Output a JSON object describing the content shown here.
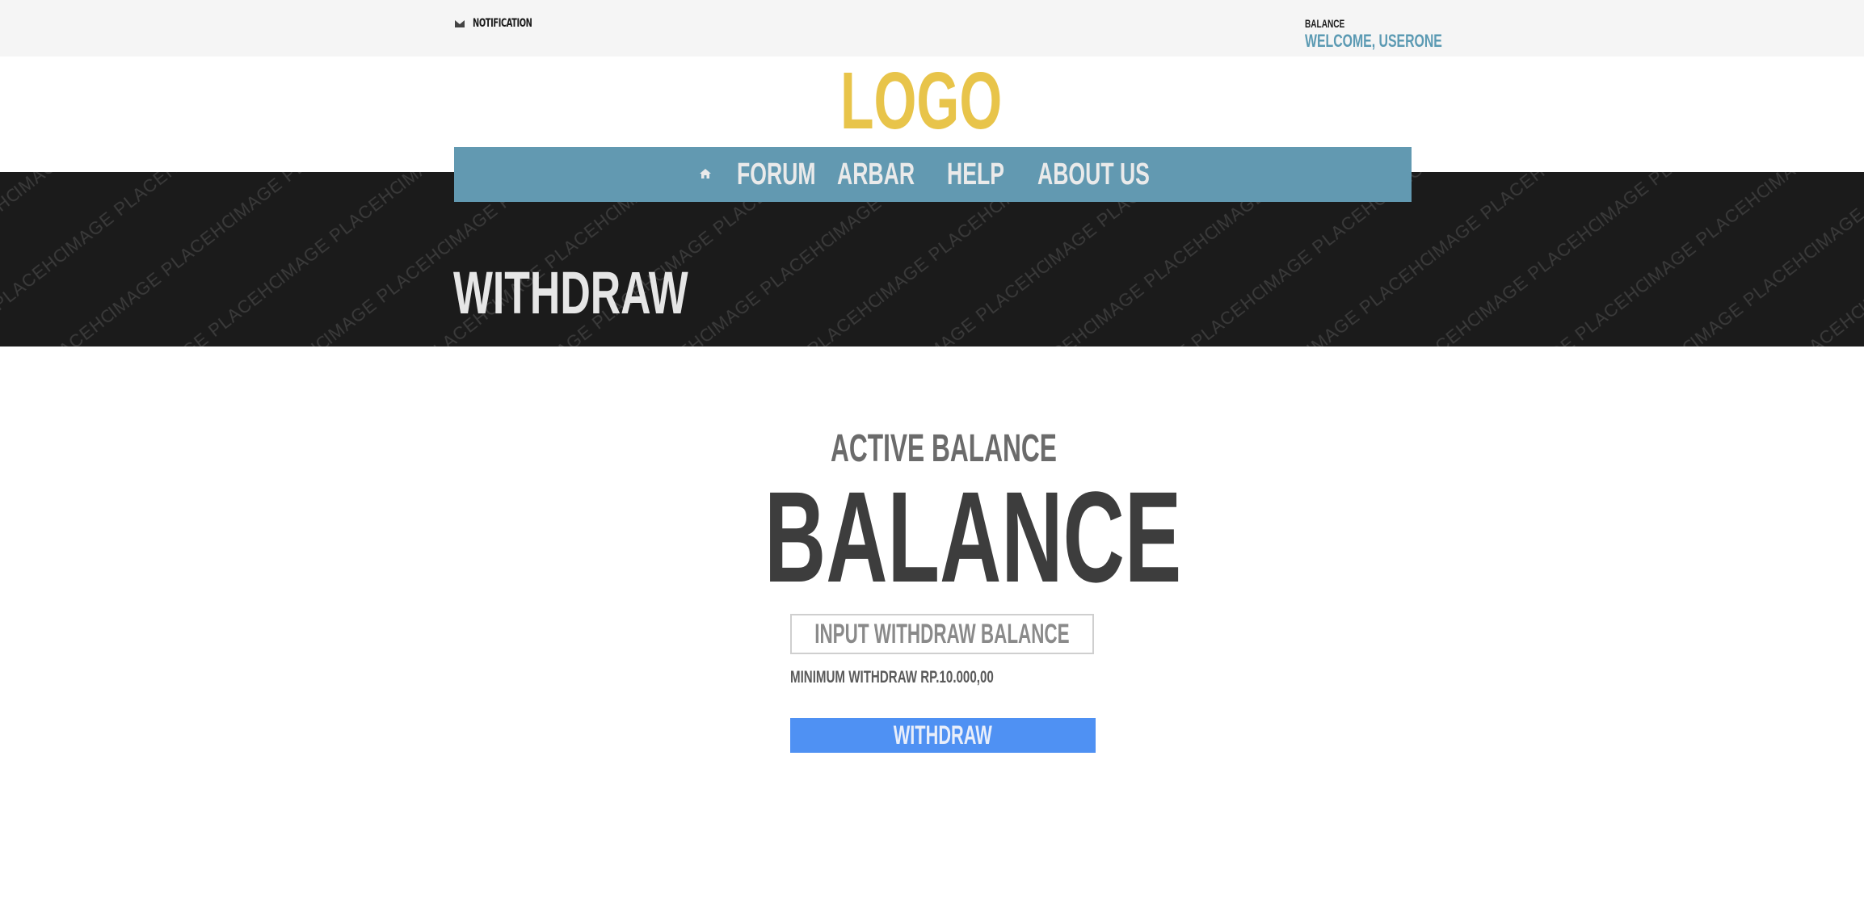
{
  "topbar": {
    "notification_label": "NOTIFICATION",
    "balance_label": "BALANCE",
    "welcome_text": "WELCOME, USERONE"
  },
  "logo": {
    "text": "LOGO",
    "color": "#e8c44a"
  },
  "nav": {
    "home_icon": "home-icon",
    "items": [
      {
        "label": "FORUM"
      },
      {
        "label": "ARBAR"
      },
      {
        "label": "HELP"
      },
      {
        "label": "ABOUT US"
      }
    ],
    "color": "#6299b1"
  },
  "hero": {
    "title": "WITHDRAW",
    "watermark": "IMAGE PLACEHOLDER"
  },
  "main": {
    "active_balance_label": "ACTIVE BALANCE",
    "balance_value": "BALANCE",
    "input_placeholder": "INPUT WITHDRAW BALANCE",
    "minimum_note": "MINIMUM WITHDRAW RP.10.000,00",
    "withdraw_button": "WITHDRAW",
    "button_color": "#4f91f3"
  }
}
